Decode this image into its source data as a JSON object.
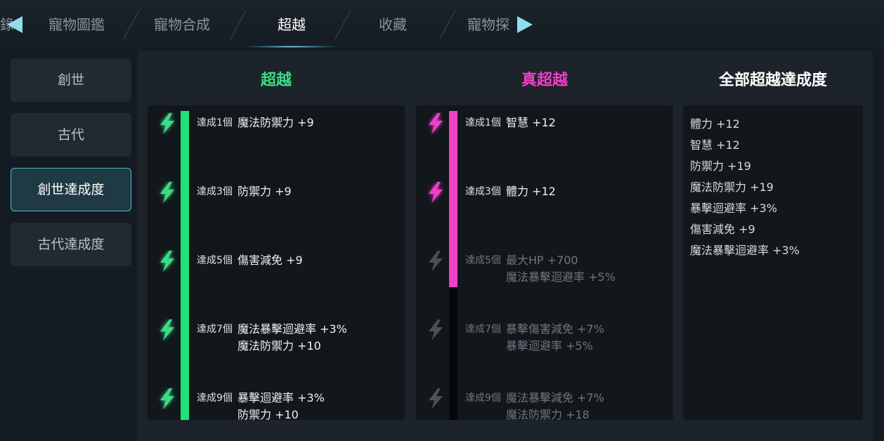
{
  "tabs": {
    "edge_label": "錄",
    "items": [
      "寵物圖鑑",
      "寵物合成",
      "超越",
      "收藏",
      "寵物探"
    ],
    "active_index": 2
  },
  "sidebar": {
    "items": [
      "創世",
      "古代",
      "創世達成度",
      "古代達成度"
    ],
    "active_index": 2
  },
  "columns": {
    "transcend": {
      "title": "超越",
      "color": "#3ddc84",
      "progress_fraction": 1.0,
      "rows": [
        {
          "label": "達成1個",
          "values": [
            "魔法防禦力 +9"
          ]
        },
        {
          "label": "達成3個",
          "values": [
            "防禦力 +9"
          ]
        },
        {
          "label": "達成5個",
          "values": [
            "傷害減免 +9"
          ]
        },
        {
          "label": "達成7個",
          "values": [
            "魔法暴擊迴避率 +3%",
            "魔法防禦力 +10"
          ]
        },
        {
          "label": "達成9個",
          "values": [
            "暴擊迴避率 +3%",
            "防禦力 +10"
          ]
        }
      ]
    },
    "true_transcend": {
      "title": "真超越",
      "color": "#f03fc8",
      "progress_fraction": 0.57,
      "rows": [
        {
          "label": "達成1個",
          "values": [
            "智慧 +12"
          ],
          "achieved": true
        },
        {
          "label": "達成3個",
          "values": [
            "體力 +12"
          ],
          "achieved": true
        },
        {
          "label": "達成5個",
          "values": [
            "最大HP +700",
            "魔法暴擊迴避率 +5%"
          ],
          "achieved": false
        },
        {
          "label": "達成7個",
          "values": [
            "暴擊傷害減免 +7%",
            "暴擊迴避率 +5%"
          ],
          "achieved": false
        },
        {
          "label": "達成9個",
          "values": [
            "魔法暴擊減免 +7%",
            "魔法防禦力 +18"
          ],
          "achieved": false
        }
      ]
    },
    "summary": {
      "title": "全部超越達成度",
      "items": [
        "體力 +12",
        "智慧 +12",
        "防禦力 +19",
        "魔法防禦力 +19",
        "暴擊迴避率 +3%",
        "傷害減免 +9",
        "魔法暴擊迴避率 +3%"
      ]
    }
  },
  "icons": {
    "bolt": "lightning-icon",
    "nav_left": "arrow-left-icon",
    "nav_right": "arrow-right-icon"
  }
}
